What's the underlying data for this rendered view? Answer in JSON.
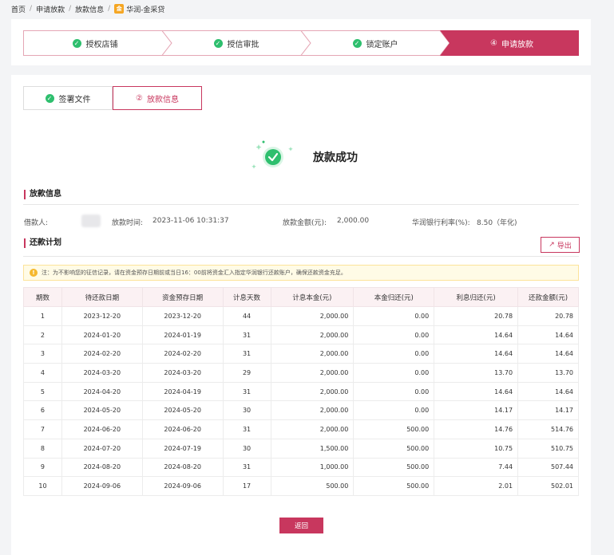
{
  "breadcrumb": {
    "items": [
      "首页",
      "申请放款",
      "放款信息"
    ],
    "brand_logo_text": "金",
    "current": "华润-金采贷"
  },
  "steps": [
    {
      "label": "授权店铺",
      "status": "done"
    },
    {
      "label": "授信审批",
      "status": "done"
    },
    {
      "label": "锁定账户",
      "status": "done"
    },
    {
      "label": "申请放款",
      "number": "④",
      "status": "active"
    }
  ],
  "tabs": [
    {
      "label": "签署文件",
      "status": "done"
    },
    {
      "label": "放款信息",
      "number": "②",
      "status": "active"
    }
  ],
  "success": {
    "title": "放款成功"
  },
  "loan_info": {
    "title": "放款信息",
    "borrower_label": "借款人:",
    "time_label": "放款时间:",
    "time_value": "2023-11-06 10:31:37",
    "amount_label": "放款金额(元):",
    "amount_value": "2,000.00",
    "rate_label": "华润银行利率(%):",
    "rate_value": "8.50（年化)"
  },
  "repayment": {
    "title": "还款计划",
    "export_label": "导出",
    "notice": "注：为不影响您的征信记录，请在资金预存日期前或当日16：00前将资金汇入指定华润银行还款账户，确保还款资金充足。",
    "headers": [
      "期数",
      "待还款日期",
      "资金预存日期",
      "计息天数",
      "计息本金(元)",
      "本金归还(元)",
      "利息归还(元)",
      "还款金额(元)"
    ],
    "rows": [
      [
        "1",
        "2023-12-20",
        "2023-12-20",
        "44",
        "2,000.00",
        "0.00",
        "20.78",
        "20.78"
      ],
      [
        "2",
        "2024-01-20",
        "2024-01-19",
        "31",
        "2,000.00",
        "0.00",
        "14.64",
        "14.64"
      ],
      [
        "3",
        "2024-02-20",
        "2024-02-20",
        "31",
        "2,000.00",
        "0.00",
        "14.64",
        "14.64"
      ],
      [
        "4",
        "2024-03-20",
        "2024-03-20",
        "29",
        "2,000.00",
        "0.00",
        "13.70",
        "13.70"
      ],
      [
        "5",
        "2024-04-20",
        "2024-04-19",
        "31",
        "2,000.00",
        "0.00",
        "14.64",
        "14.64"
      ],
      [
        "6",
        "2024-05-20",
        "2024-05-20",
        "30",
        "2,000.00",
        "0.00",
        "14.17",
        "14.17"
      ],
      [
        "7",
        "2024-06-20",
        "2024-06-20",
        "31",
        "2,000.00",
        "500.00",
        "14.76",
        "514.76"
      ],
      [
        "8",
        "2024-07-20",
        "2024-07-19",
        "30",
        "1,500.00",
        "500.00",
        "10.75",
        "510.75"
      ],
      [
        "9",
        "2024-08-20",
        "2024-08-20",
        "31",
        "1,000.00",
        "500.00",
        "7.44",
        "507.44"
      ],
      [
        "10",
        "2024-09-06",
        "2024-09-06",
        "17",
        "500.00",
        "500.00",
        "2.01",
        "502.01"
      ]
    ]
  },
  "back_label": "返回",
  "colors": {
    "accent": "#c8375e",
    "success": "#2ebf6e",
    "notice_bg": "#fffbe6",
    "warn": "#f5b82e"
  }
}
